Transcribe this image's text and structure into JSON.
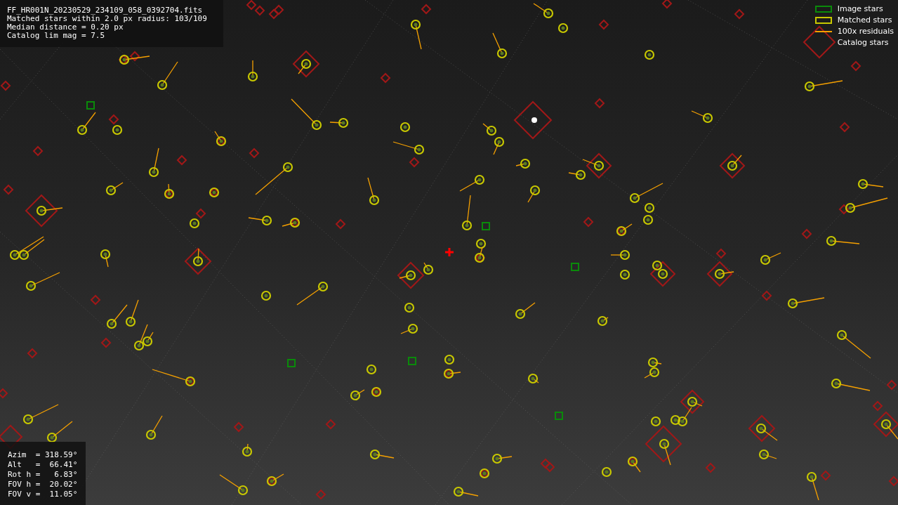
{
  "info_panel": {
    "lines": [
      "FF_HR001N_20230529_234109_058_0392704.fits",
      "Matched stars within 2.0 px radius: 103/109",
      "Median distance = 0.20 px",
      "Catalog lim mag = 7.5"
    ]
  },
  "legend": {
    "items": [
      {
        "kind": "image",
        "label": "Image stars"
      },
      {
        "kind": "matched",
        "label": "Matched stars"
      },
      {
        "kind": "residual",
        "label": "100x residuals"
      },
      {
        "kind": "catalog",
        "label": "Catalog stars"
      }
    ]
  },
  "pointing_panel": {
    "lines": [
      "Azim  = 318.59°",
      "Alt   =  66.41°",
      "Rot h =   6.83°",
      "FOV h =  20.02°",
      "FOV v =  11.05°"
    ]
  }
}
